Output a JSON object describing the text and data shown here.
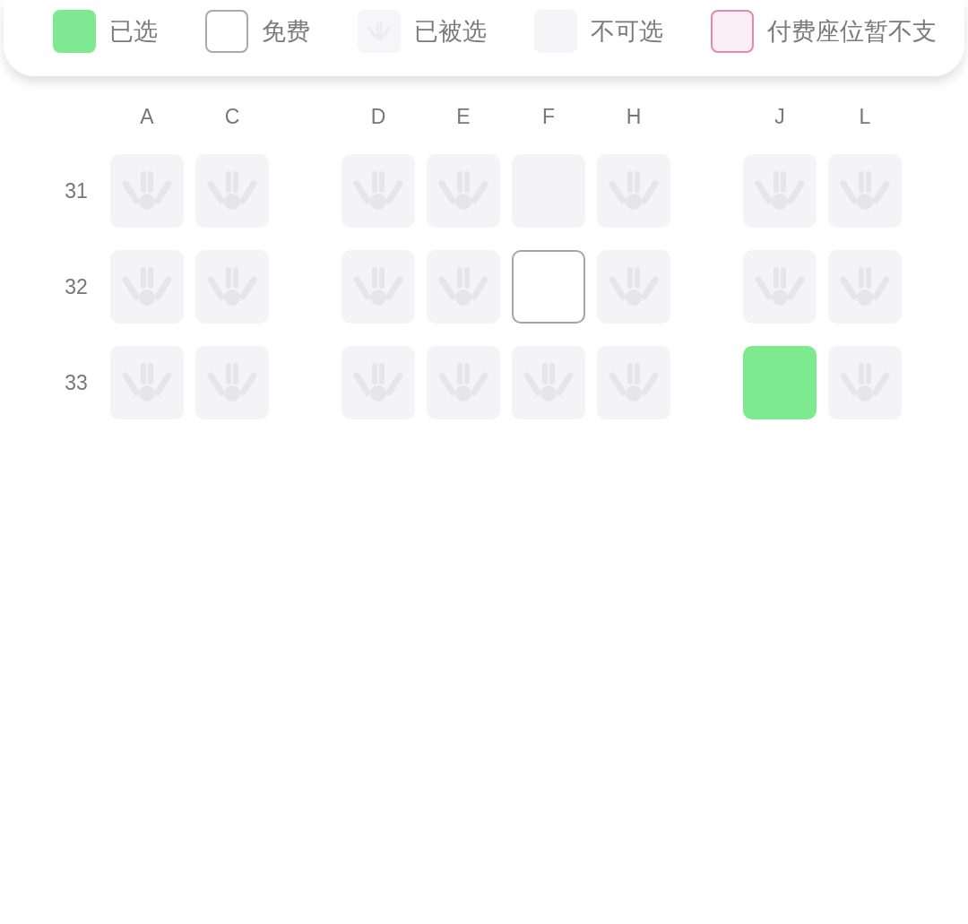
{
  "legend": [
    {
      "kind": "selected",
      "label": "已选"
    },
    {
      "kind": "free",
      "label": "免费"
    },
    {
      "kind": "taken",
      "label": "已被选"
    },
    {
      "kind": "unavailable",
      "label": "不可选"
    },
    {
      "kind": "paid",
      "label": "付费座位暂不支"
    }
  ],
  "seat_map": {
    "sections": [
      {
        "columns": [
          "A",
          "C"
        ]
      },
      {
        "columns": [
          "D",
          "E",
          "F",
          "H"
        ]
      },
      {
        "columns": [
          "J",
          "L"
        ]
      }
    ],
    "rows": [
      {
        "number": "31",
        "seats": [
          {
            "kind": "taken",
            "selected": false
          },
          {
            "kind": "taken",
            "selected": false
          },
          {
            "kind": "taken",
            "selected": false
          },
          {
            "kind": "taken",
            "selected": false
          },
          {
            "kind": "unavailable",
            "selected": false
          },
          {
            "kind": "taken",
            "selected": false
          },
          {
            "kind": "taken",
            "selected": false
          },
          {
            "kind": "taken",
            "selected": false
          }
        ]
      },
      {
        "number": "32",
        "seats": [
          {
            "kind": "taken",
            "selected": false
          },
          {
            "kind": "taken",
            "selected": false
          },
          {
            "kind": "taken",
            "selected": false
          },
          {
            "kind": "taken",
            "selected": false
          },
          {
            "kind": "free",
            "selected": false
          },
          {
            "kind": "taken",
            "selected": false
          },
          {
            "kind": "taken",
            "selected": false
          },
          {
            "kind": "taken",
            "selected": false
          }
        ]
      },
      {
        "number": "33",
        "seats": [
          {
            "kind": "taken",
            "selected": false
          },
          {
            "kind": "taken",
            "selected": false
          },
          {
            "kind": "taken",
            "selected": false
          },
          {
            "kind": "taken",
            "selected": false
          },
          {
            "kind": "taken",
            "selected": false
          },
          {
            "kind": "taken",
            "selected": false
          },
          {
            "kind": "free",
            "selected": true
          },
          {
            "kind": "taken",
            "selected": false
          }
        ]
      }
    ]
  }
}
